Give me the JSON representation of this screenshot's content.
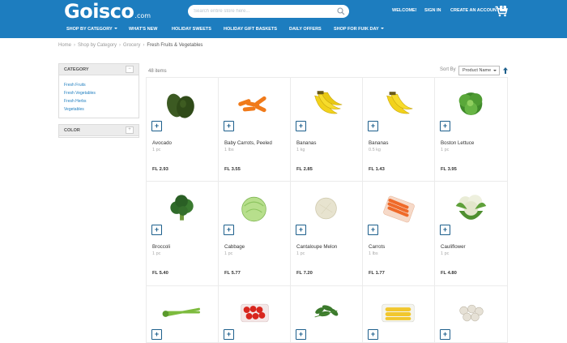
{
  "header": {
    "logo_main": "Goisco",
    "logo_suffix": ".com",
    "search_placeholder": "Search entire store here...",
    "links": [
      "WELCOME!",
      "SIGN IN",
      "CREATE AN ACCOUNT"
    ],
    "cart_count": "0",
    "colors": {
      "brand": "#1d7dbf",
      "accent_dark": "#1d5f8c"
    }
  },
  "nav": [
    {
      "label": "SHOP BY CATEGORY",
      "dropdown": true
    },
    {
      "label": "WHAT'S NEW",
      "dropdown": false
    },
    {
      "label": "HOLIDAY SWEETS",
      "dropdown": false
    },
    {
      "label": "HOLIDAY GIFT BASKETS",
      "dropdown": false
    },
    {
      "label": "DAILY OFFERS",
      "dropdown": false
    },
    {
      "label": "SHOP FOR FUIK DAY",
      "dropdown": true
    }
  ],
  "breadcrumb": [
    "Home",
    "Shop by Category",
    "Grocery",
    "Fresh Fruits & Vegetables"
  ],
  "sidebar": {
    "category_title": "CATEGORY",
    "category_toggle": "−",
    "category_links": [
      "Fresh Fruits",
      "Fresh Vegetables",
      "Fresh Herbs",
      "Vegetables"
    ],
    "color_title": "COLOR",
    "color_toggle": "+"
  },
  "listing": {
    "count": "48 items",
    "sort_label": "Sort By",
    "sort_value": "Product Name",
    "add_label": "+"
  },
  "products": [
    {
      "name": "Avocado",
      "unit": "1 pc",
      "price": "FL 2.93",
      "icon": "avocado-image"
    },
    {
      "name": "Baby Carrots, Peeled",
      "unit": "1 lbs",
      "price": "FL 3.55",
      "icon": "baby-carrots-image"
    },
    {
      "name": "Bananas",
      "unit": "1 kg",
      "price": "FL 2.85",
      "icon": "bananas-image"
    },
    {
      "name": "Bananas",
      "unit": "0.5 kg",
      "price": "FL 1.43",
      "icon": "bananas-image"
    },
    {
      "name": "Boston Lettuce",
      "unit": "1 pc",
      "price": "FL 3.95",
      "icon": "lettuce-image"
    },
    {
      "name": "Broccoli",
      "unit": "1 pc",
      "price": "FL 5.40",
      "icon": "broccoli-image"
    },
    {
      "name": "Cabbage",
      "unit": "1 pc",
      "price": "FL 5.77",
      "icon": "cabbage-image"
    },
    {
      "name": "Cantaloupe Melon",
      "unit": "1 pc",
      "price": "FL 7.20",
      "icon": "melon-image"
    },
    {
      "name": "Carrots",
      "unit": "1 lbs",
      "price": "FL 1.77",
      "icon": "carrots-image"
    },
    {
      "name": "Cauliflower",
      "unit": "1 pc",
      "price": "FL 4.80",
      "icon": "cauliflower-image"
    },
    {
      "icon": "celery-image"
    },
    {
      "icon": "tomatoes-image"
    },
    {
      "icon": "herbs-image"
    },
    {
      "icon": "corn-image"
    },
    {
      "icon": "mushrooms-image"
    }
  ]
}
